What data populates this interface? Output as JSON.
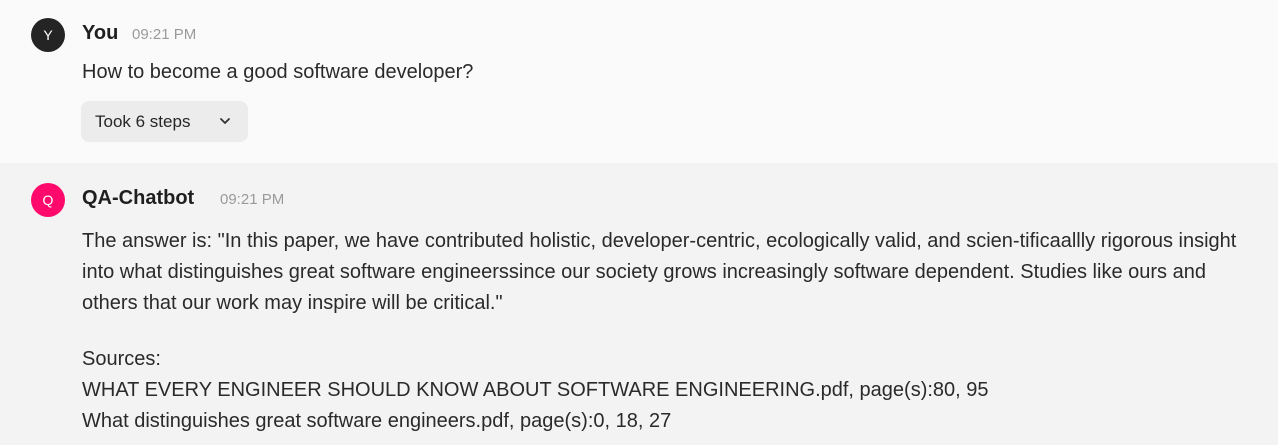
{
  "user_message": {
    "avatar_letter": "Y",
    "author": "You",
    "time": "09:21 PM",
    "text": "How to become a good software developer?",
    "steps_label": "Took 6 steps",
    "steps_icon": "chevron-down-icon"
  },
  "bot_message": {
    "avatar_letter": "Q",
    "author": "QA-Chatbot",
    "time": "09:21 PM",
    "answer": "The answer is: \"In this paper, we have contributed holistic, developer-centric, ecologically valid, and scien-tificaallly rigorous insight into what distinguishes great software engineerssince our society grows increasingly software dependent. Studies like ours and others that our work may inspire will be critical.\"",
    "sources_heading": "Sources:",
    "sources": [
      "WHAT EVERY ENGINEER SHOULD KNOW ABOUT SOFTWARE ENGINEERING.pdf, page(s):80, 95",
      "What distinguishes great software engineers.pdf, page(s):0, 18, 27"
    ]
  },
  "colors": {
    "user_bg": "#fafafa",
    "bot_bg": "#f3f3f3",
    "user_avatar": "#242424",
    "bot_avatar": "#ff0a6c",
    "timestamp": "#9a9a9a",
    "steps_button_bg": "#ececec"
  }
}
